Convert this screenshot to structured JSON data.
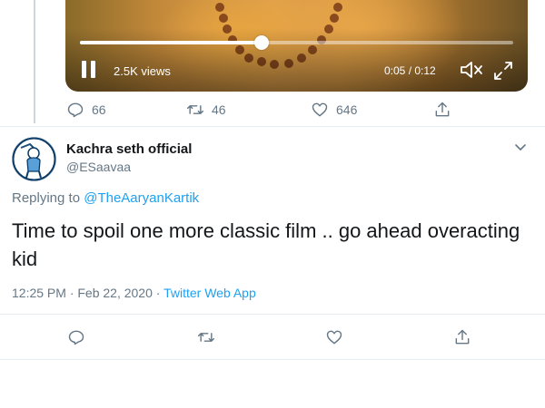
{
  "video": {
    "views": "2.5K views",
    "time": "0:05 / 0:12",
    "progress_fraction": 0.42
  },
  "parent_actions": {
    "reply_count": "66",
    "retweet_count": "46",
    "like_count": "646"
  },
  "tweet": {
    "display_name": "Kachra seth official",
    "handle": "@ESaavaa",
    "replying_prefix": "Replying to ",
    "replying_to": "@TheAaryanKartik",
    "text": "Time to spoil one more classic film .. go ahead overacting kid",
    "timestamp": "12:25 PM · Feb 22, 2020 · ",
    "source": "Twitter Web App"
  },
  "icons": {
    "reply": "reply-icon",
    "retweet": "retweet-icon",
    "like": "heart-icon",
    "share": "share-icon",
    "mute": "mute-icon",
    "fullscreen": "fullscreen-icon",
    "pause": "pause-icon",
    "caret": "chevron-down-icon"
  },
  "colors": {
    "accent": "#1da1f2",
    "muted_text": "#657786",
    "text": "#14171a",
    "divider": "#e6ecf0"
  }
}
